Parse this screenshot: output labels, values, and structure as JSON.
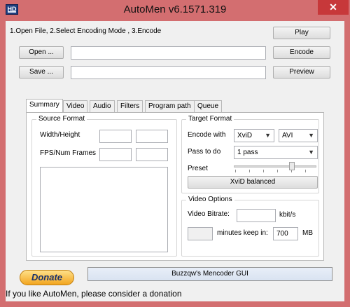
{
  "window": {
    "title": "AutoMen v6.1571.319",
    "close_glyph": "✕",
    "app_icon_label": "HD"
  },
  "header": {
    "steps": "1.Open File, 2.Select Encoding Mode , 3.Encode",
    "play_label": "Play",
    "open_label": "Open ...",
    "encode_label": "Encode",
    "save_label": "Save ...",
    "preview_label": "Preview",
    "open_path": "",
    "save_path": ""
  },
  "tabs": [
    "Summary",
    "Video",
    "Audio",
    "Filters",
    "Program path",
    "Queue"
  ],
  "source_format": {
    "title": "Source Format",
    "width_height_label": "Width/Height",
    "fps_frames_label": "FPS/Num Frames"
  },
  "target_format": {
    "title": "Target Format",
    "encode_with_label": "Encode with",
    "encoder_value": "XviD",
    "container_value": "AVI",
    "pass_label": "Pass to do",
    "pass_value": "1 pass",
    "preset_label": "Preset",
    "preset_value": "XviD balanced"
  },
  "video_options": {
    "title": "Video Options",
    "bitrate_label": "Video Bitrate:",
    "bitrate_value": "",
    "bitrate_unit": "kbit/s",
    "minutes_label": "minutes keep in:",
    "minutes_value": "",
    "size_value": "700",
    "size_unit": "MB"
  },
  "footer": {
    "donate_label": "Donate",
    "status_text": "Buzzqw's Mencoder GUI",
    "message": "If you like AutoMen, please consider a donation"
  },
  "colors": {
    "window_frame": "#d36e70",
    "close_button": "#c7383a"
  }
}
